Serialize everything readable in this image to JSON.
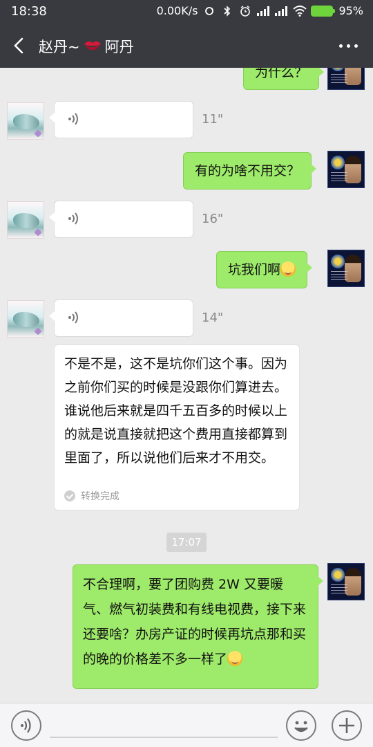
{
  "status_bar": {
    "time": "18:38",
    "network_speed": "0.00K/s",
    "battery_percent": "95%",
    "icons": [
      "sync-icon",
      "bluetooth-icon",
      "alarm-icon",
      "signal-icon",
      "signal-icon",
      "wifi-icon",
      "battery-icon"
    ]
  },
  "header": {
    "back_icon": "chevron-left-icon",
    "title_part1": "赵丹~",
    "title_emoji": "kiss-mark-emoji",
    "title_part2": "阿丹",
    "more_icon": "more-dots-icon"
  },
  "messages": [
    {
      "side": "right",
      "type": "text",
      "text": "为什么？"
    },
    {
      "side": "left",
      "type": "voice",
      "duration": "11\""
    },
    {
      "side": "right",
      "type": "text",
      "text": "有的为啥不用交？"
    },
    {
      "side": "left",
      "type": "voice",
      "duration": "16\""
    },
    {
      "side": "right",
      "type": "text",
      "text": "坑我们啊",
      "emoji": "laugh-tears-emoji"
    },
    {
      "side": "left",
      "type": "voice",
      "duration": "14\"",
      "transcript": "不是不是，这不是坑你们这个事。因为之前你们买的时候是没跟你们算进去。谁说他后来就是四千五百多的时候以上的就是说直接就把这个费用直接都算到里面了，所以说他们后来才不用交。",
      "transcript_status": "转换完成"
    },
    {
      "side": "right",
      "type": "text",
      "text": "不合理啊，要了团购费 2W 又要暖气、燃气初装费和有线电视费，接下来还要啥？办房产证的时候再坑点那和买的晚的价格差不多一样了",
      "emoji": "smirk-emoji"
    }
  ],
  "timestamp": "17:07",
  "input_bar": {
    "voice_toggle_icon": "voice-input-icon",
    "emoji_icon": "emoji-icon",
    "plus_icon": "plus-icon"
  },
  "colors": {
    "header_bg": "#393a3f",
    "chat_bg": "#ebebeb",
    "sent_bubble": "#9eea6a",
    "received_bubble": "#ffffff"
  }
}
